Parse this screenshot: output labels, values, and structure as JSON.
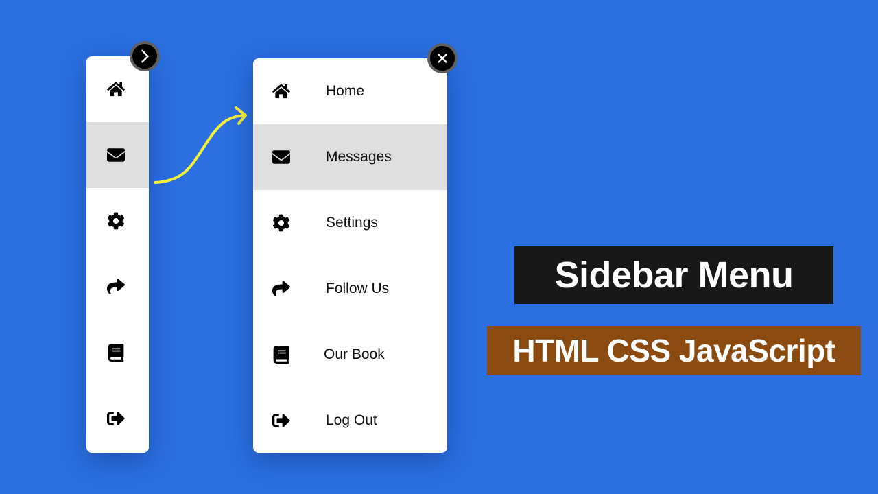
{
  "colors": {
    "background": "#2b6fe0",
    "panel": "#ffffff",
    "active_item": "#dedede",
    "toggle_button": "#000000",
    "arrow": "#f2f23a",
    "title_bg": "#181818",
    "subtitle_bg": "#8b4a0f"
  },
  "collapsed_sidebar": {
    "toggle_icon": "chevron-right-icon",
    "active_index": 1,
    "items": [
      {
        "icon": "home-icon"
      },
      {
        "icon": "envelope-icon"
      },
      {
        "icon": "gear-icon"
      },
      {
        "icon": "share-icon"
      },
      {
        "icon": "book-icon"
      },
      {
        "icon": "logout-icon"
      }
    ]
  },
  "expanded_sidebar": {
    "toggle_icon": "close-icon",
    "active_index": 1,
    "items": [
      {
        "icon": "home-icon",
        "label": "Home"
      },
      {
        "icon": "envelope-icon",
        "label": "Messages"
      },
      {
        "icon": "gear-icon",
        "label": "Settings"
      },
      {
        "icon": "share-icon",
        "label": "Follow Us"
      },
      {
        "icon": "book-icon",
        "label": "Our Book"
      },
      {
        "icon": "logout-icon",
        "label": "Log Out"
      }
    ]
  },
  "banner": {
    "title": "Sidebar Menu",
    "subtitle": "HTML CSS JavaScript"
  }
}
